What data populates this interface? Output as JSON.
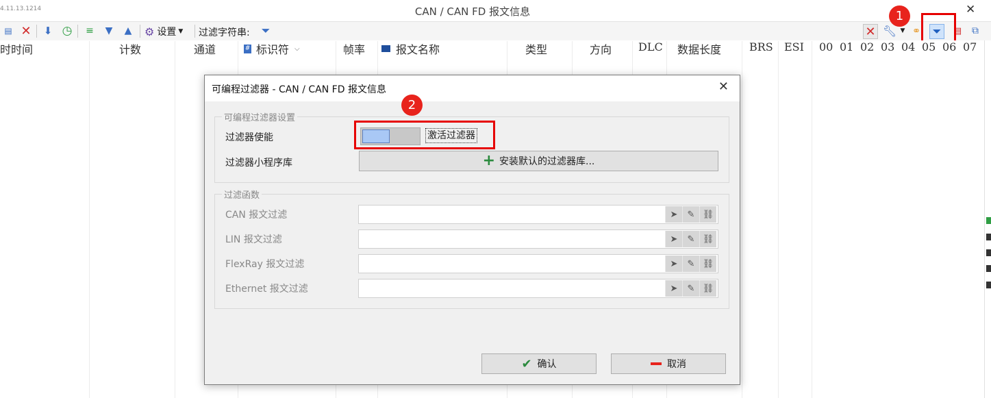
{
  "window": {
    "version_text": "4.11.13.1214",
    "title": "CAN / CAN FD 报文信息",
    "close_glyph": "✕"
  },
  "toolbar": {
    "settings_label": "设置",
    "filter_string_label": "过滤字符串:"
  },
  "columns": [
    "时时间",
    "计数",
    "通道",
    "标识符",
    "帧率",
    "报文名称",
    "类型",
    "方向",
    "DLC",
    "数据长度",
    "BRS",
    "ESI",
    "00",
    "01",
    "02",
    "03",
    "04",
    "05",
    "06",
    "07"
  ],
  "badges": {
    "one": "1",
    "two": "2"
  },
  "dialog": {
    "title": "可编程过滤器 - CAN / CAN FD 报文信息",
    "settings_group": {
      "label": "可编程过滤器设置",
      "enable_label": "过滤器使能",
      "enable_state": false,
      "activate_button": "激活过滤器",
      "library_label": "过滤器小程序库",
      "install_button": "安装默认的过滤器库..."
    },
    "functions_group": {
      "label": "过滤函数",
      "rows": [
        {
          "label": "CAN 报文过滤",
          "value": ""
        },
        {
          "label": "LIN 报文过滤",
          "value": ""
        },
        {
          "label": "FlexRay 报文过滤",
          "value": ""
        },
        {
          "label": "Ethernet 报文过滤",
          "value": ""
        }
      ]
    },
    "ok_button": "确认",
    "cancel_button": "取消"
  },
  "colors": {
    "highlight_red": "#e60000",
    "badge_red": "#e8231c",
    "toggle_knob": "#a9c8f5",
    "accent_blue": "#3b6fc4"
  }
}
